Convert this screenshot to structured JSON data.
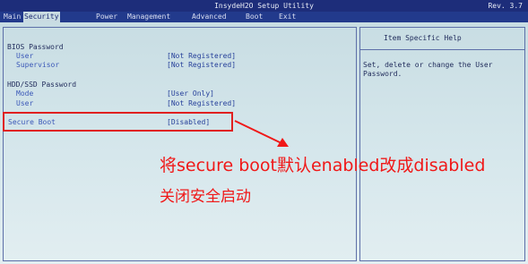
{
  "window": {
    "title": "InsydeH2O Setup Utility",
    "rev": "Rev. 3.7"
  },
  "menu": {
    "items": [
      {
        "label": "Main",
        "active": false
      },
      {
        "label": "Security",
        "active": true
      },
      {
        "label": "Power",
        "active": false
      },
      {
        "label": "Management",
        "active": false
      },
      {
        "label": "Advanced",
        "active": false
      },
      {
        "label": "Boot",
        "active": false
      },
      {
        "label": "Exit",
        "active": false
      }
    ]
  },
  "bios_password": {
    "heading": "BIOS Password",
    "user_label": "User",
    "user_value": "[Not Registered]",
    "supervisor_label": "Supervisor",
    "supervisor_value": "[Not Registered]"
  },
  "hdd_password": {
    "heading": "HDD/SSD Password",
    "mode_label": "Mode",
    "mode_value": "[User Only]",
    "user_label": "User",
    "user_value": "[Not Registered]"
  },
  "secure_boot": {
    "label": "Secure Boot",
    "value": "[Disabled]"
  },
  "help": {
    "title": "Item Specific Help",
    "text": "Set, delete or change the User Password."
  },
  "annotation": {
    "line1": "将secure boot默认enabled改成disabled",
    "line2": "关闭安全启动",
    "color": "#f01818"
  }
}
